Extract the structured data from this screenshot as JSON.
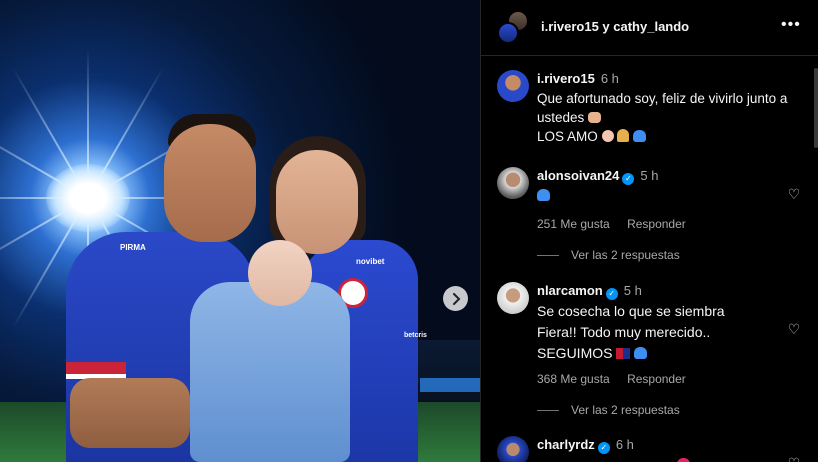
{
  "photo": {
    "sponsor_novibet": "novibet",
    "sponsor_pirma": "PIRMA",
    "sponsor_betcris": "betcris"
  },
  "header": {
    "title": "i.rivero15 y cathy_lando",
    "more_glyph": "•••"
  },
  "comments": [
    {
      "user": "i.rivero15",
      "verified": false,
      "time": "6 h",
      "lines": [
        "Que afortunado soy, feliz de vivirlo junto a",
        "ustedes",
        "LOS AMO"
      ]
    },
    {
      "user": "alonsoivan24",
      "verified": true,
      "time": "5 h",
      "likes": "251 Me gusta",
      "reply_label": "Responder",
      "view_replies": "Ver las 2 respuestas"
    },
    {
      "user": "nlarcamon",
      "verified": true,
      "time": "5 h",
      "lines": [
        "Se cosecha lo que se siembra",
        "Fiera!! Todo muy merecido..",
        "SEGUIMOS"
      ],
      "likes": "368 Me gusta",
      "reply_label": "Responder",
      "view_replies": "Ver las 2 respuestas"
    },
    {
      "user": "charlyrdz",
      "verified": true,
      "time": "6 h"
    }
  ],
  "icons": {
    "next": "chevron-right-icon",
    "like": "heart-outline-icon",
    "more": "more-horizontal-icon",
    "verified": "verified-badge-icon"
  },
  "colors": {
    "background": "#000000",
    "text": "#f5f5f5",
    "muted": "#a8a8a8",
    "verified": "#0095f6",
    "kit_blue": "#2a49c8",
    "kit_red": "#c9243a"
  }
}
